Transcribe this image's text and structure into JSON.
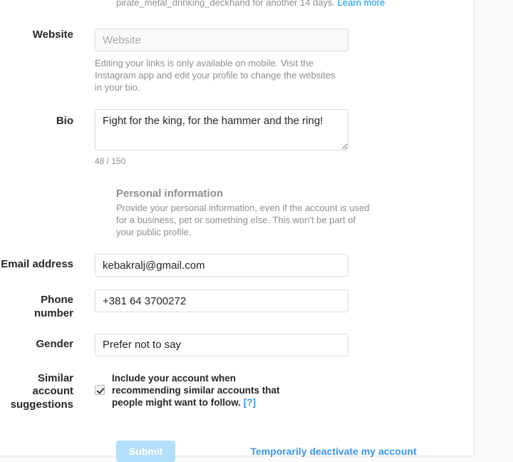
{
  "notice": {
    "text": "pirate_metal_drinking_deckhand for another 14 days.",
    "link_label": "Learn more"
  },
  "fields": {
    "website": {
      "label": "Website",
      "value": "",
      "placeholder": "Website",
      "helper": "Editing your links is only available on mobile. Visit the Instagram app and edit your profile to change the websites in your bio."
    },
    "bio": {
      "label": "Bio",
      "value": "Fight for the king, for the hammer and the ring!",
      "counter": "48 / 150"
    },
    "email": {
      "label": "Email address",
      "value": "kebakralj@gmail.com"
    },
    "phone": {
      "label": "Phone number",
      "value": "+381 64 3700272"
    },
    "gender": {
      "label": "Gender",
      "value": "Prefer not to say"
    },
    "similar_accounts": {
      "label": "Similar account suggestions",
      "checkbox_text": "Include your account when recommending similar accounts that people might want to follow.",
      "help_label": "[?]",
      "checked": true
    }
  },
  "personal_information": {
    "title": "Personal information",
    "description": "Provide your personal information, even if the account is used for a business, pet or something else. This won't be part of your public profile."
  },
  "actions": {
    "submit_label": "Submit",
    "deactivate_label": "Temporarily deactivate my account"
  },
  "colors": {
    "link_blue": "#3897f0",
    "notice_blue": "#0095f6",
    "submit_disabled": "#b2dffc",
    "text_primary": "#262626",
    "text_secondary": "#8e8e8e",
    "border": "#dbdbdb",
    "page_background": "#fafafa"
  }
}
